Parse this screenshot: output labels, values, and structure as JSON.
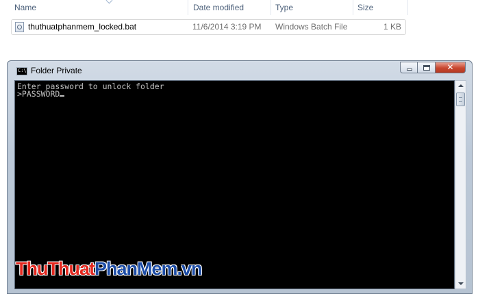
{
  "explorer": {
    "columns": [
      "Name",
      "Date modified",
      "Type",
      "Size"
    ],
    "file": {
      "name": "thuthuatphanmem_locked.bat",
      "date_modified": "11/6/2014 3:19 PM",
      "type": "Windows Batch File",
      "size": "1 KB",
      "icon": "batch-file-icon"
    }
  },
  "console": {
    "title": "Folder Private",
    "title_icon_text": "C:\\",
    "lines": [
      "Enter password to unlock folder",
      ">PASSWORD"
    ],
    "background": "#000000",
    "text_color": "#c0c0c0"
  },
  "watermark": {
    "part1": "Thu",
    "part2": "Thuat",
    "part3": "PhanMem",
    "part4": ".vn",
    "red": "#e3271e",
    "blue": "#1c4ca6"
  }
}
